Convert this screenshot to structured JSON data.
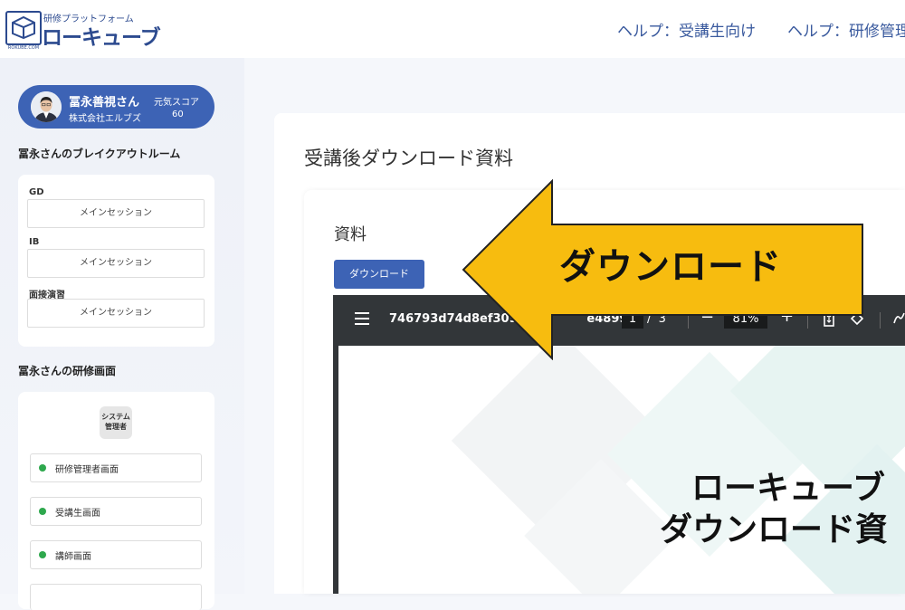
{
  "header": {
    "logo_sub": "研修プラットフォーム",
    "logo_main": "ローキューブ",
    "logo_tag": "ROKUBE.COM",
    "links": [
      "ヘルプ：受講生向け",
      "ヘルプ：研修管理"
    ]
  },
  "sidebar": {
    "user": {
      "name": "冨永善視さん",
      "company": "株式会社エルブズ",
      "score_label": "元気スコア",
      "score_value": "60"
    },
    "breakout_title": "冨永さんのブレイクアウトルーム",
    "breakouts": [
      {
        "group": "GD",
        "button": "メインセッション"
      },
      {
        "group": "IB",
        "button": "メインセッション"
      },
      {
        "group": "面接演習",
        "button": "メインセッション"
      }
    ],
    "training_title": "冨永さんの研修画面",
    "system_admin_label": "システム管理者",
    "nav_items": [
      "研修管理者画面",
      "受講生画面",
      "講師画面"
    ]
  },
  "main": {
    "title": "受講後ダウンロード資料",
    "section_title": "資料",
    "download_button": "ダウンロード"
  },
  "pdf": {
    "filename": "746793d74d8ef309a",
    "filename_tail": "e4899...",
    "page": "1",
    "page_sep": "/",
    "total_pages": "3",
    "zoom": "81%",
    "doc_title_line1": "ローキューブ",
    "doc_title_line2": "ダウンロード資"
  },
  "callout": {
    "text": "ダウンロード",
    "color": "#f7bc0f"
  }
}
